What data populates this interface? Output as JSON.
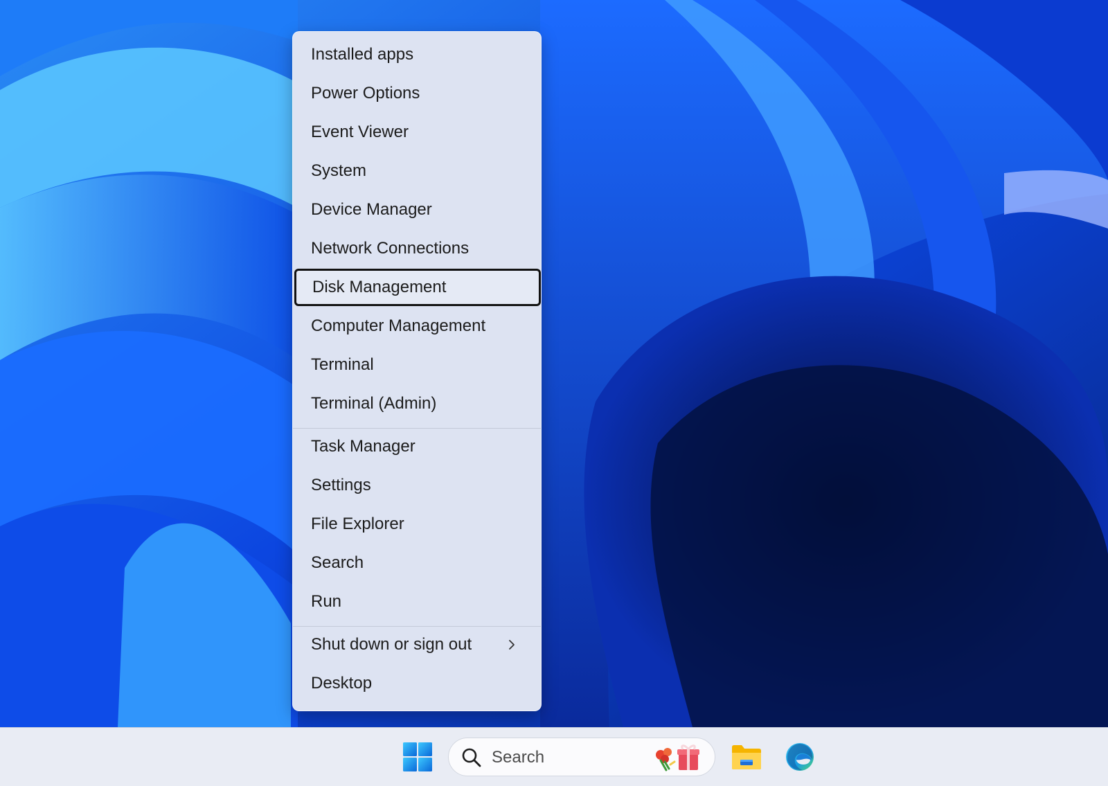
{
  "menu": {
    "items": [
      {
        "label": "Installed apps"
      },
      {
        "label": "Power Options"
      },
      {
        "label": "Event Viewer"
      },
      {
        "label": "System"
      },
      {
        "label": "Device Manager"
      },
      {
        "label": "Network Connections"
      },
      {
        "label": "Disk Management",
        "focused": true
      },
      {
        "label": "Computer Management"
      },
      {
        "label": "Terminal"
      },
      {
        "label": "Terminal (Admin)"
      },
      {
        "label": "Task Manager"
      },
      {
        "label": "Settings"
      },
      {
        "label": "File Explorer"
      },
      {
        "label": "Search"
      },
      {
        "label": "Run"
      },
      {
        "label": "Shut down or sign out",
        "submenu": true
      },
      {
        "label": "Desktop"
      }
    ]
  },
  "taskbar": {
    "search": {
      "placeholder": "Search"
    },
    "icons": {
      "start": "windows-start-icon",
      "search": "search-icon",
      "search_highlight": "search-highlight-gift-icon",
      "explorer": "file-explorer-icon",
      "edge": "edge-browser-icon"
    }
  },
  "colors": {
    "accent": "#0a3fd6",
    "menu_background": "#dde3f2",
    "taskbar_background": "#e9ecf4"
  }
}
